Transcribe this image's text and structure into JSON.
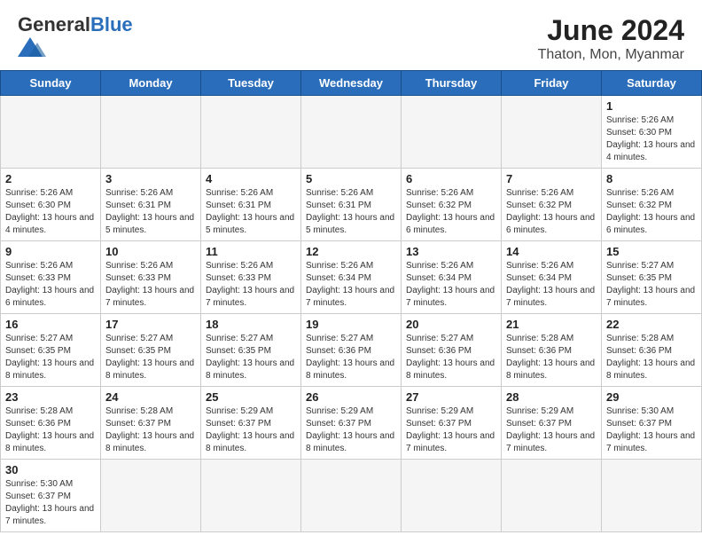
{
  "header": {
    "logo_general": "General",
    "logo_blue": "Blue",
    "title": "June 2024",
    "subtitle": "Thaton, Mon, Myanmar"
  },
  "weekdays": [
    "Sunday",
    "Monday",
    "Tuesday",
    "Wednesday",
    "Thursday",
    "Friday",
    "Saturday"
  ],
  "weeks": [
    [
      {
        "day": "",
        "info": ""
      },
      {
        "day": "",
        "info": ""
      },
      {
        "day": "",
        "info": ""
      },
      {
        "day": "",
        "info": ""
      },
      {
        "day": "",
        "info": ""
      },
      {
        "day": "",
        "info": ""
      },
      {
        "day": "1",
        "info": "Sunrise: 5:26 AM\nSunset: 6:30 PM\nDaylight: 13 hours and 4 minutes."
      }
    ],
    [
      {
        "day": "2",
        "info": "Sunrise: 5:26 AM\nSunset: 6:30 PM\nDaylight: 13 hours and 4 minutes."
      },
      {
        "day": "3",
        "info": "Sunrise: 5:26 AM\nSunset: 6:31 PM\nDaylight: 13 hours and 5 minutes."
      },
      {
        "day": "4",
        "info": "Sunrise: 5:26 AM\nSunset: 6:31 PM\nDaylight: 13 hours and 5 minutes."
      },
      {
        "day": "5",
        "info": "Sunrise: 5:26 AM\nSunset: 6:31 PM\nDaylight: 13 hours and 5 minutes."
      },
      {
        "day": "6",
        "info": "Sunrise: 5:26 AM\nSunset: 6:32 PM\nDaylight: 13 hours and 6 minutes."
      },
      {
        "day": "7",
        "info": "Sunrise: 5:26 AM\nSunset: 6:32 PM\nDaylight: 13 hours and 6 minutes."
      },
      {
        "day": "8",
        "info": "Sunrise: 5:26 AM\nSunset: 6:32 PM\nDaylight: 13 hours and 6 minutes."
      }
    ],
    [
      {
        "day": "9",
        "info": "Sunrise: 5:26 AM\nSunset: 6:33 PM\nDaylight: 13 hours and 6 minutes."
      },
      {
        "day": "10",
        "info": "Sunrise: 5:26 AM\nSunset: 6:33 PM\nDaylight: 13 hours and 7 minutes."
      },
      {
        "day": "11",
        "info": "Sunrise: 5:26 AM\nSunset: 6:33 PM\nDaylight: 13 hours and 7 minutes."
      },
      {
        "day": "12",
        "info": "Sunrise: 5:26 AM\nSunset: 6:34 PM\nDaylight: 13 hours and 7 minutes."
      },
      {
        "day": "13",
        "info": "Sunrise: 5:26 AM\nSunset: 6:34 PM\nDaylight: 13 hours and 7 minutes."
      },
      {
        "day": "14",
        "info": "Sunrise: 5:26 AM\nSunset: 6:34 PM\nDaylight: 13 hours and 7 minutes."
      },
      {
        "day": "15",
        "info": "Sunrise: 5:27 AM\nSunset: 6:35 PM\nDaylight: 13 hours and 7 minutes."
      }
    ],
    [
      {
        "day": "16",
        "info": "Sunrise: 5:27 AM\nSunset: 6:35 PM\nDaylight: 13 hours and 8 minutes."
      },
      {
        "day": "17",
        "info": "Sunrise: 5:27 AM\nSunset: 6:35 PM\nDaylight: 13 hours and 8 minutes."
      },
      {
        "day": "18",
        "info": "Sunrise: 5:27 AM\nSunset: 6:35 PM\nDaylight: 13 hours and 8 minutes."
      },
      {
        "day": "19",
        "info": "Sunrise: 5:27 AM\nSunset: 6:36 PM\nDaylight: 13 hours and 8 minutes."
      },
      {
        "day": "20",
        "info": "Sunrise: 5:27 AM\nSunset: 6:36 PM\nDaylight: 13 hours and 8 minutes."
      },
      {
        "day": "21",
        "info": "Sunrise: 5:28 AM\nSunset: 6:36 PM\nDaylight: 13 hours and 8 minutes."
      },
      {
        "day": "22",
        "info": "Sunrise: 5:28 AM\nSunset: 6:36 PM\nDaylight: 13 hours and 8 minutes."
      }
    ],
    [
      {
        "day": "23",
        "info": "Sunrise: 5:28 AM\nSunset: 6:36 PM\nDaylight: 13 hours and 8 minutes."
      },
      {
        "day": "24",
        "info": "Sunrise: 5:28 AM\nSunset: 6:37 PM\nDaylight: 13 hours and 8 minutes."
      },
      {
        "day": "25",
        "info": "Sunrise: 5:29 AM\nSunset: 6:37 PM\nDaylight: 13 hours and 8 minutes."
      },
      {
        "day": "26",
        "info": "Sunrise: 5:29 AM\nSunset: 6:37 PM\nDaylight: 13 hours and 8 minutes."
      },
      {
        "day": "27",
        "info": "Sunrise: 5:29 AM\nSunset: 6:37 PM\nDaylight: 13 hours and 7 minutes."
      },
      {
        "day": "28",
        "info": "Sunrise: 5:29 AM\nSunset: 6:37 PM\nDaylight: 13 hours and 7 minutes."
      },
      {
        "day": "29",
        "info": "Sunrise: 5:30 AM\nSunset: 6:37 PM\nDaylight: 13 hours and 7 minutes."
      }
    ],
    [
      {
        "day": "30",
        "info": "Sunrise: 5:30 AM\nSunset: 6:37 PM\nDaylight: 13 hours and 7 minutes."
      },
      {
        "day": "",
        "info": ""
      },
      {
        "day": "",
        "info": ""
      },
      {
        "day": "",
        "info": ""
      },
      {
        "day": "",
        "info": ""
      },
      {
        "day": "",
        "info": ""
      },
      {
        "day": "",
        "info": ""
      }
    ]
  ]
}
